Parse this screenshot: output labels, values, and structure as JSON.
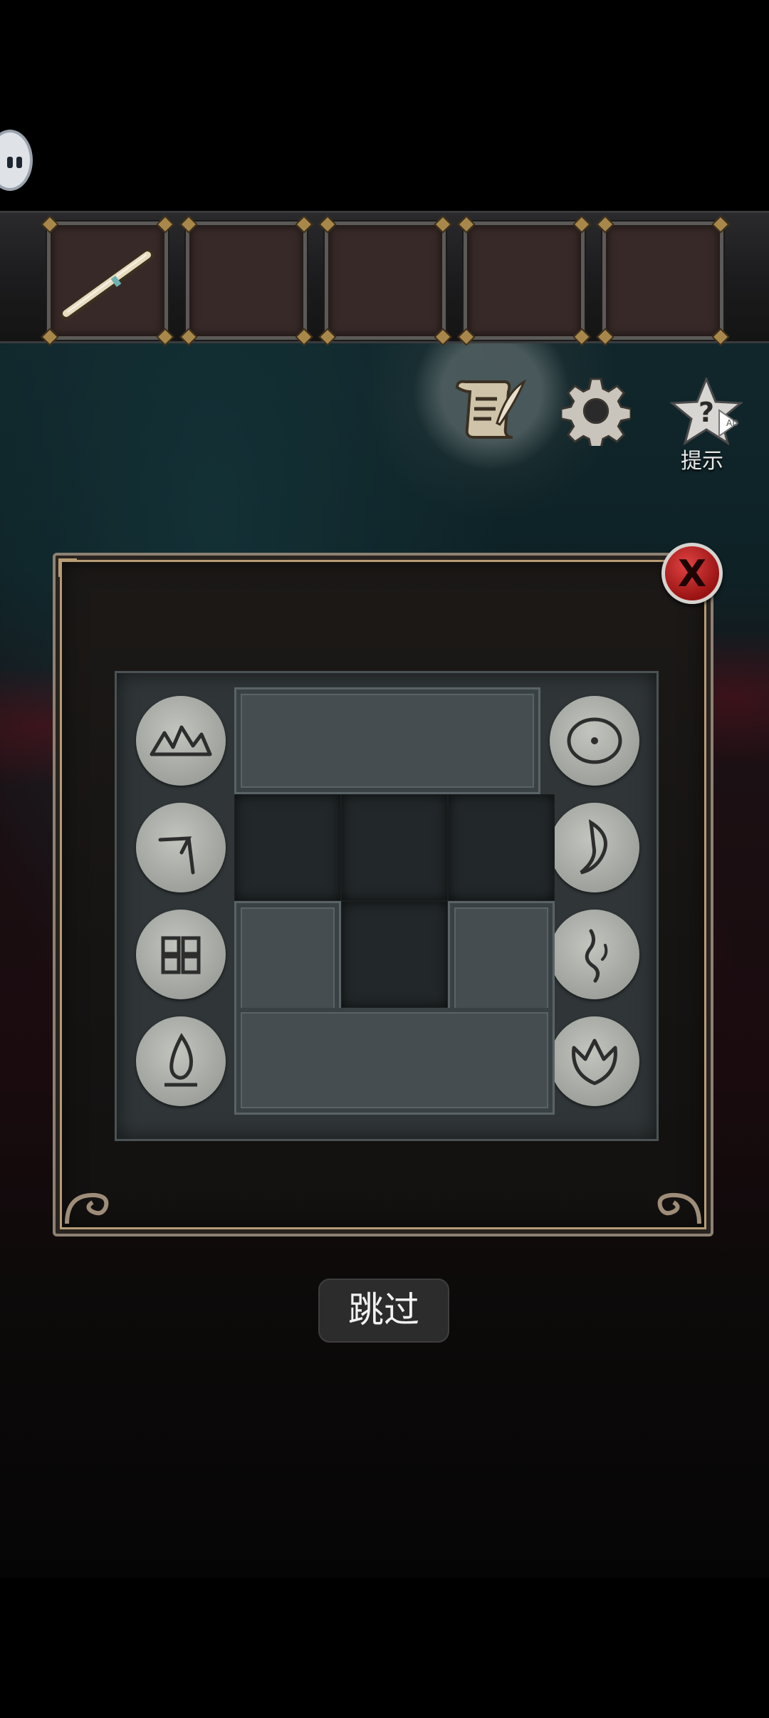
{
  "hud": {
    "pause_icon": "pause-icon",
    "inventory_slots": [
      {
        "item": "scroll-rod-icon"
      },
      {
        "item": ""
      },
      {
        "item": ""
      },
      {
        "item": ""
      },
      {
        "item": ""
      }
    ],
    "journal_icon": "scroll-quill-icon",
    "settings_icon": "gear-icon",
    "hint_icon": "star-question-icon",
    "hint_badge": "AD",
    "hint_label": "提示"
  },
  "puzzle": {
    "close_label": "X",
    "left_symbols": [
      "mountain-glyph-icon",
      "angle-glyph-icon",
      "window-glyph-icon",
      "flame-glyph-icon"
    ],
    "right_symbols": [
      "eye-glyph-icon",
      "moon-glyph-icon",
      "water-glyph-icon",
      "flower-glyph-icon"
    ]
  },
  "skip_label": "跳过",
  "colors": {
    "close_red": "#c81f1f",
    "frame_gold": "#b79c74",
    "stone": "#a8aaa5",
    "slab": "#454d50"
  }
}
